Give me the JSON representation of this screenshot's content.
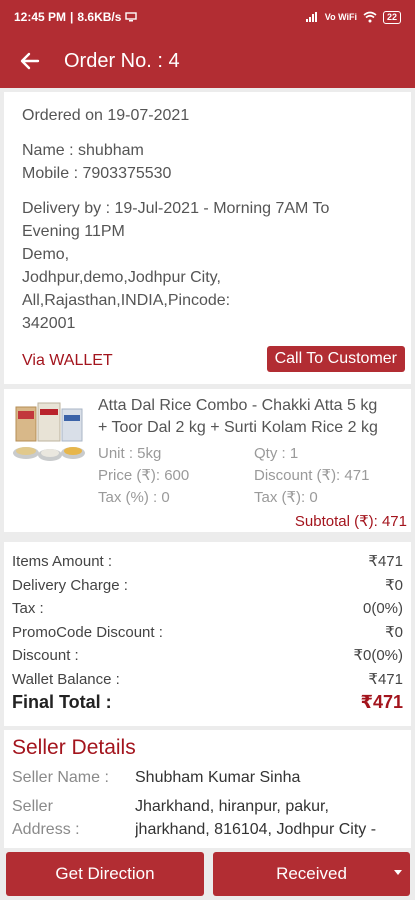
{
  "status_bar": {
    "time": "12:45 PM",
    "speed": "8.6KB/s",
    "network": "Vo WiFi",
    "battery": "22"
  },
  "app_bar": {
    "title": "Order No. : 4"
  },
  "order": {
    "ordered_on": "Ordered on 19-07-2021",
    "name": "Name : shubham",
    "mobile": "Mobile : 7903375530",
    "delivery_line1": "Delivery by : 19-Jul-2021 - Morning 7AM To",
    "delivery_line2": "Evening 11PM",
    "address_line1": "Demo,",
    "address_line2": "Jodhpur,demo,Jodhpur City,",
    "address_line3": "All,Rajasthan,INDIA,Pincode:",
    "address_line4": "342001",
    "payment_method": "Via WALLET",
    "call_button": "Call To Customer"
  },
  "product": {
    "title_line1": "Atta Dal Rice Combo - Chakki Atta 5 kg",
    "title_line2": "+ Toor Dal 2 kg + Surti Kolam Rice 2 kg",
    "unit": "Unit : 5kg",
    "qty": "Qty : 1",
    "price": "Price (₹): 600",
    "discount": "Discount (₹): 471",
    "tax_percent": "Tax (%) : 0",
    "tax_amount": "Tax (₹): 0",
    "subtotal": "Subtotal (₹): 471"
  },
  "totals": {
    "rows": [
      {
        "label": "Items Amount :",
        "value": "₹471"
      },
      {
        "label": "Delivery Charge :",
        "value": "₹0"
      },
      {
        "label": "Tax :",
        "value": "0(0%)"
      },
      {
        "label": "PromoCode Discount :",
        "value": "₹0"
      },
      {
        "label": "Discount :",
        "value": "₹0(0%)"
      },
      {
        "label": "Wallet Balance :",
        "value": "₹471"
      }
    ],
    "final_label": "Final Total :",
    "final_value": "₹471"
  },
  "seller": {
    "heading": "Seller Details",
    "name_label": "Seller Name :",
    "name_value": "Shubham Kumar Sinha",
    "address_label_1": "Seller",
    "address_label_2": "Address :",
    "address_value_1": "Jharkhand, hiranpur, pakur,",
    "address_value_2": "jharkhand, 816104, Jodhpur City -"
  },
  "actions": {
    "direction_label": "Get Direction",
    "status_label": "Received"
  }
}
